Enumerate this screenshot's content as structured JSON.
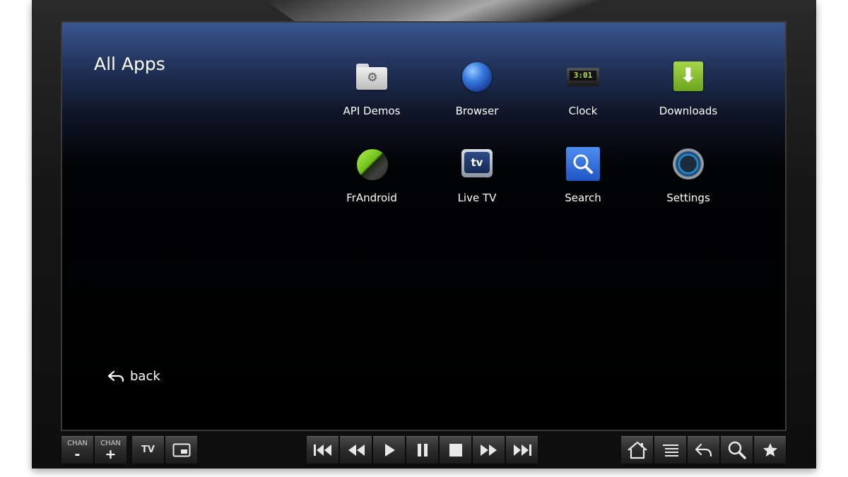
{
  "screen": {
    "title": "All Apps",
    "apps": [
      {
        "label": "API Demos",
        "icon": "folder-gear-icon"
      },
      {
        "label": "Browser",
        "icon": "globe-icon"
      },
      {
        "label": "Clock",
        "icon": "clock-icon",
        "display": "3:01"
      },
      {
        "label": "Downloads",
        "icon": "download-arrow-icon"
      },
      {
        "label": "FrAndroid",
        "icon": "frandroid-ball-icon"
      },
      {
        "label": "Live TV",
        "icon": "tv-icon",
        "badge": "tv"
      },
      {
        "label": "Search",
        "icon": "magnifier-icon"
      },
      {
        "label": "Settings",
        "icon": "settings-knob-icon"
      }
    ],
    "back_label": "back"
  },
  "controls": {
    "chan_minus": {
      "caption": "CHAN",
      "symbol": "-"
    },
    "chan_plus": {
      "caption": "CHAN",
      "symbol": "+"
    },
    "tv_label": "TV",
    "pip": "picture-in-picture-icon",
    "media": [
      "skip-previous-icon",
      "rewind-icon",
      "play-icon",
      "pause-icon",
      "stop-icon",
      "fast-forward-icon",
      "skip-next-icon"
    ],
    "nav": [
      "home-icon",
      "menu-icon",
      "back-arrow-icon",
      "search-icon",
      "star-icon"
    ]
  },
  "colors": {
    "accent_blue": "#3a5690",
    "clock_digits": "#b9e34a",
    "download_green": "#7ab82a"
  }
}
